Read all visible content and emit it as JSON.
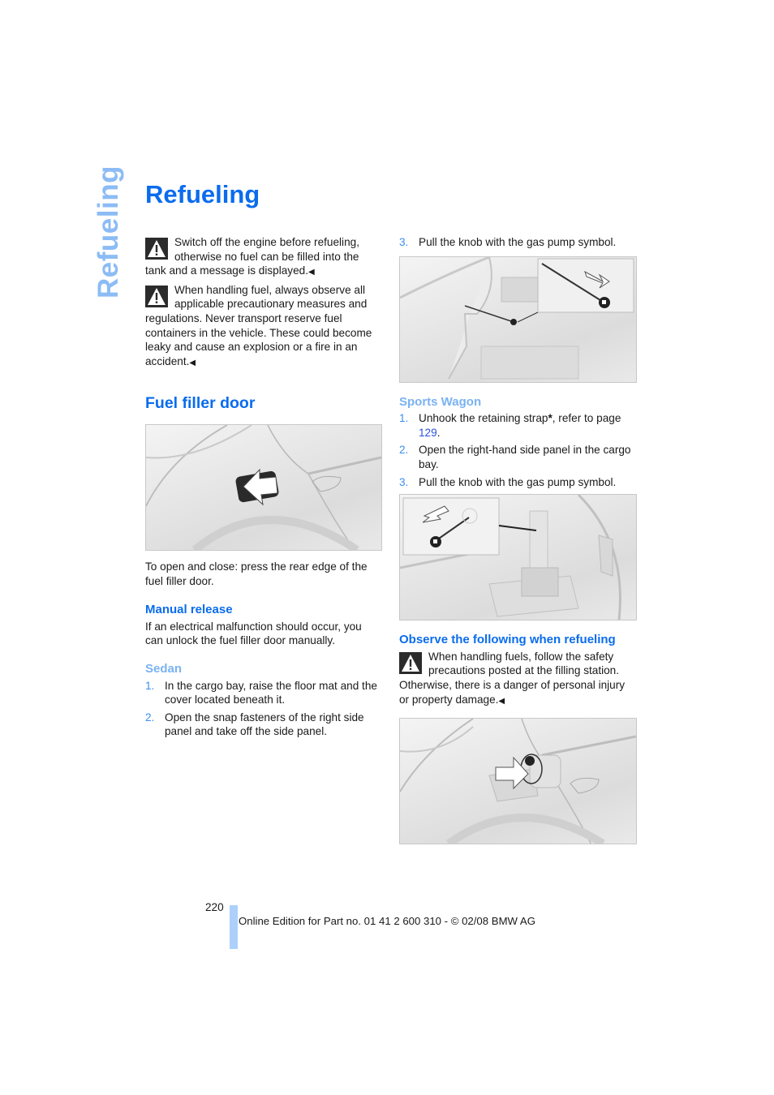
{
  "sidebar": {
    "section_title": "Refueling"
  },
  "page": {
    "title": "Refueling",
    "page_number": "220",
    "footer": "Online Edition for Part no. 01 41 2 600 310 - © 02/08 BMW AG"
  },
  "colors": {
    "heading_blue": "#0a6cee",
    "subheading_light_blue": "#7ab2f2",
    "sidebar_blue": "#8cbcf5",
    "footer_bar": "#acd0fa"
  },
  "left_column": {
    "warnings": [
      {
        "icon": "warning-triangle-icon",
        "text": "Switch off the engine before refueling, otherwise no fuel can be filled into the tank and a message is displayed.",
        "end_mark": "◀"
      },
      {
        "icon": "warning-triangle-icon",
        "text": "When handling fuel, always observe all applicable precautionary measures and regulations. Never transport reserve fuel containers in the vehicle. These could become leaky and cause an explosion or a fire in an accident.",
        "end_mark": "◀"
      }
    ],
    "fuel_filler_door": {
      "heading": "Fuel filler door",
      "figure_alt": "Fuel filler door on car rear side panel with arrow",
      "caption": "To open and close: press the rear edge of the fuel filler door."
    },
    "manual_release": {
      "heading": "Manual release",
      "text": "If an electrical malfunction should occur, you can unlock the fuel filler door manually."
    },
    "sedan": {
      "heading": "Sedan",
      "steps": [
        {
          "num": "1.",
          "text": "In the cargo bay, raise the floor mat and the cover located beneath it."
        },
        {
          "num": "2.",
          "text": "Open the snap fasteners of the right side panel and take off the side panel."
        }
      ]
    }
  },
  "right_column": {
    "sedan_step3": {
      "num": "3.",
      "text": "Pull the knob with the gas pump symbol."
    },
    "sedan_figure_alt": "Gas pump symbol knob inside sedan cargo bay",
    "sports_wagon": {
      "heading": "Sports Wagon",
      "steps": [
        {
          "num": "1.",
          "text_before": "Unhook the retaining strap",
          "asterisk": "*",
          "text_mid": ", refer to page ",
          "page_link": "129",
          "text_after": "."
        },
        {
          "num": "2.",
          "text": "Open the right-hand side panel in the cargo bay."
        },
        {
          "num": "3.",
          "text": "Pull the knob with the gas pump symbol."
        }
      ],
      "figure_alt": "Gas pump symbol knob inside sports wagon cargo bay"
    },
    "observe": {
      "heading": "Observe the following when refueling",
      "warning": {
        "icon": "warning-triangle-icon",
        "text": "When handling fuels, follow the safety precautions posted at the filling station. Otherwise, there is a danger of personal injury or property damage.",
        "end_mark": "◀"
      },
      "figure_alt": "Open fuel filler door with fuel cap and arrow"
    }
  }
}
